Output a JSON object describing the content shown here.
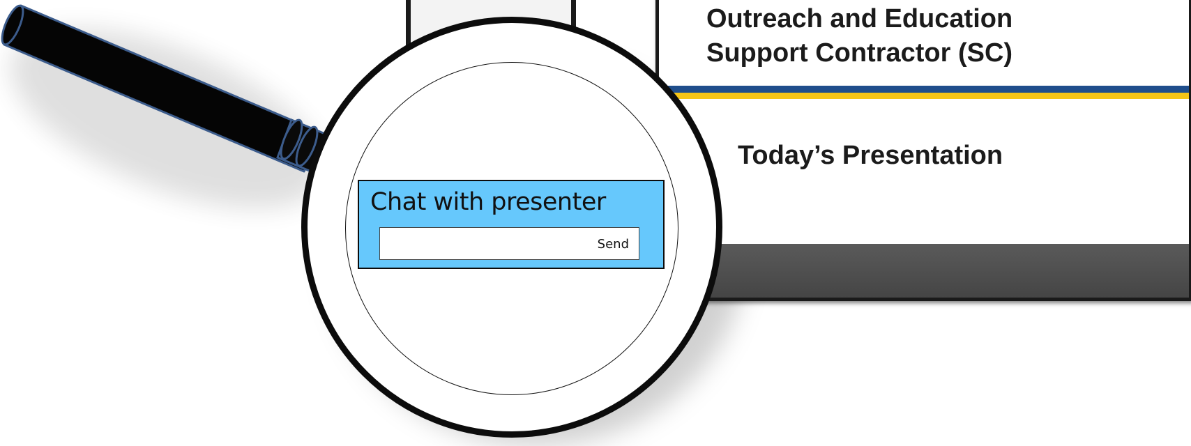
{
  "slide": {
    "heading": "Outreach and Education\nSupport Contractor (SC)",
    "subtitle": "Today’s Presentation",
    "colors": {
      "stripe_blue": "#1f4e8c",
      "stripe_gold": "#f5c518",
      "footer": "#4d4d4d"
    }
  },
  "magnifier": {
    "icon": "magnifying-glass-icon"
  },
  "chat": {
    "title": "Chat with presenter",
    "input_value": "",
    "send_label": "Send",
    "colors": {
      "panel": "#66c8fc"
    }
  }
}
